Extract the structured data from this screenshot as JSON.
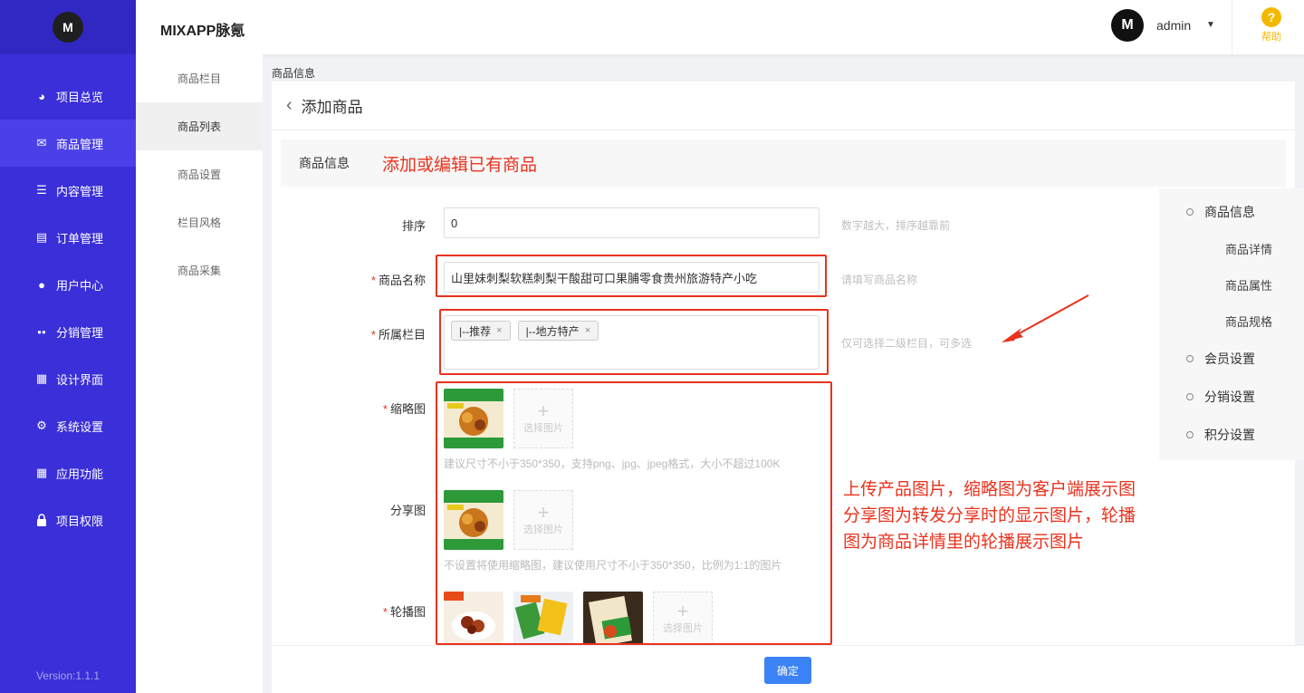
{
  "app": {
    "brand": "MIXAPP脉氪",
    "logo_text": "M",
    "version": "Version:1.1.1"
  },
  "nav": {
    "items": [
      {
        "label": "项目总览",
        "icon": "pie-chart-icon",
        "glyph": "◕"
      },
      {
        "label": "商品管理",
        "icon": "mail-icon",
        "glyph": "✉"
      },
      {
        "label": "内容管理",
        "icon": "list-icon",
        "glyph": "☰"
      },
      {
        "label": "订单管理",
        "icon": "document-icon",
        "glyph": "▤"
      },
      {
        "label": "用户中心",
        "icon": "user-icon",
        "glyph": "●"
      },
      {
        "label": "分销管理",
        "icon": "users-icon",
        "glyph": "●●"
      },
      {
        "label": "设计界面",
        "icon": "layout-icon",
        "glyph": "▦"
      },
      {
        "label": "系统设置",
        "icon": "gear-icon",
        "glyph": "⚙"
      },
      {
        "label": "应用功能",
        "icon": "grid-icon",
        "glyph": "▦"
      },
      {
        "label": "项目权限",
        "icon": "lock-icon",
        "glyph": "🔒"
      }
    ]
  },
  "subnav": {
    "items": [
      "商品栏目",
      "商品列表",
      "商品设置",
      "栏目风格",
      "商品采集"
    ]
  },
  "header": {
    "user": "admin",
    "help": "帮助"
  },
  "page": {
    "breadcrumb": "商品信息",
    "title": "添加商品",
    "section_label": "商品信息",
    "section_annotation": "添加或编辑已有商品"
  },
  "form": {
    "sort": {
      "label": "排序",
      "value": "0",
      "hint": "数字越大，排序越靠前"
    },
    "name": {
      "label": "商品名称",
      "value": "山里妹刺梨软糕刺梨干酸甜可口果脯零食贵州旅游特产小吃",
      "hint": "请填写商品名称"
    },
    "category": {
      "label": "所属栏目",
      "tags": [
        "|--推荐",
        "|--地方特产"
      ],
      "hint": "仅可选择二级栏目，可多选"
    },
    "thumb": {
      "label": "缩略图",
      "select": "选择图片",
      "hint": "建议尺寸不小于350*350，支持png、jpg、jpeg格式，大小不超过100K"
    },
    "share": {
      "label": "分享图",
      "select": "选择图片",
      "hint": "不设置将使用缩略图，建议使用尺寸不小于350*350，比例为1:1的图片"
    },
    "carousel": {
      "label": "轮播图",
      "select": "选择图片"
    },
    "image_annotation": [
      "上传产品图片，缩略图为客户端展示图",
      "分享图为转发分享时的显示图片，轮播",
      "图为商品详情里的轮播展示图片"
    ]
  },
  "anchors": {
    "items": [
      {
        "label": "商品信息",
        "level": 1
      },
      {
        "label": "商品详情",
        "level": 2
      },
      {
        "label": "商品属性",
        "level": 2
      },
      {
        "label": "商品规格",
        "level": 2
      },
      {
        "label": "会员设置",
        "level": 1
      },
      {
        "label": "分销设置",
        "level": 1
      },
      {
        "label": "积分设置",
        "level": 1
      }
    ]
  },
  "footer": {
    "confirm": "确定"
  },
  "colors": {
    "nav_bg": "#3a2fd8",
    "annotation": "#e8331e",
    "primary": "#3b82f6",
    "help": "#f5b800"
  }
}
